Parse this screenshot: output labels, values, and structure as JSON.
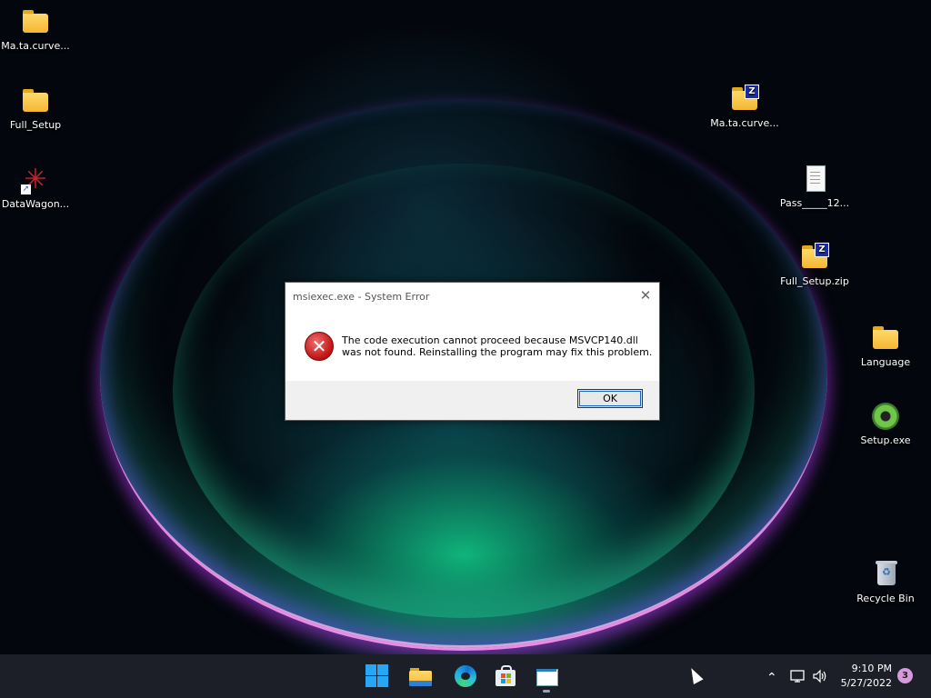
{
  "desktop": {
    "left_icons": [
      {
        "label": "Ma.ta.curve...",
        "icon": "folder-icon"
      },
      {
        "label": "Full_Setup",
        "icon": "folder-icon"
      },
      {
        "label": "DataWagon...",
        "icon": "datawagon-shortcut-icon"
      }
    ],
    "right_icons": [
      {
        "label": "Ma.ta.curve...",
        "icon": "zip-folder-icon"
      },
      {
        "label": "Pass_____12...",
        "icon": "text-document-icon"
      },
      {
        "label": "Full_Setup.zip",
        "icon": "zip-folder-icon"
      },
      {
        "label": "Language",
        "icon": "folder-icon"
      },
      {
        "label": "Setup.exe",
        "icon": "setup-disc-icon"
      },
      {
        "label": "Recycle Bin",
        "icon": "recycle-bin-icon"
      }
    ]
  },
  "dialog": {
    "title": "msiexec.exe - System Error",
    "close_glyph": "✕",
    "icon": "error-icon",
    "message_line1": "The code execution cannot proceed because MSVCP140.dll",
    "message_line2": "was not found. Reinstalling the program may fix this problem.",
    "ok_label": "OK"
  },
  "taskbar": {
    "apps": [
      "start-icon",
      "file-explorer-icon",
      "edge-icon",
      "store-icon",
      "running-app-icon"
    ],
    "tray": {
      "chevron_glyph": "⌃",
      "time": "9:10 PM",
      "date": "5/27/2022",
      "notification_count": "3"
    }
  },
  "colors": {
    "taskbar_bg": "#1c1f27",
    "error_red": "#c21818",
    "accent": "#0a64d6"
  }
}
